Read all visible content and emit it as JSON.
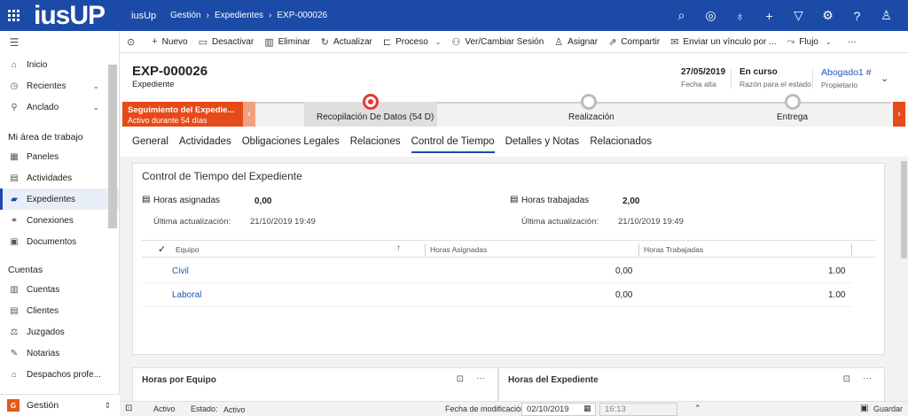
{
  "topbar": {
    "logo": "iusUP",
    "app_name": "iusUp",
    "breadcrumb": [
      "Gestión",
      "Expedientes",
      "EXP-000026"
    ],
    "icons": [
      "search-icon",
      "task-icon",
      "lightbulb-icon",
      "plus-icon",
      "filter-icon",
      "gear-icon",
      "help-icon",
      "user-icon"
    ]
  },
  "sidebar": {
    "top_items": [
      {
        "label": "Inicio",
        "icon": "home-icon"
      },
      {
        "label": "Recientes",
        "icon": "clock-icon",
        "expandable": true
      },
      {
        "label": "Anclado",
        "icon": "pin-icon",
        "expandable": true
      }
    ],
    "section1_title": "Mi área de trabajo",
    "section1_items": [
      {
        "label": "Paneles",
        "icon": "dashboard-icon"
      },
      {
        "label": "Actividades",
        "icon": "activities-icon"
      },
      {
        "label": "Expedientes",
        "icon": "folder-icon",
        "active": true
      },
      {
        "label": "Conexiones",
        "icon": "connections-icon"
      },
      {
        "label": "Documentos",
        "icon": "document-icon"
      }
    ],
    "section2_title": "Cuentas",
    "section2_items": [
      {
        "label": "Cuentas",
        "icon": "accounts-icon"
      },
      {
        "label": "Clientes",
        "icon": "clients-icon"
      },
      {
        "label": "Juzgados",
        "icon": "court-icon"
      },
      {
        "label": "Notarias",
        "icon": "notary-icon"
      },
      {
        "label": "Despachos profe...",
        "icon": "office-icon"
      }
    ],
    "area_badge": "G",
    "area_label": "Gestión"
  },
  "commands": [
    {
      "label": "Nuevo",
      "icon": "plus-icon"
    },
    {
      "label": "Desactivar",
      "icon": "deactivate-icon"
    },
    {
      "label": "Eliminar",
      "icon": "trash-icon"
    },
    {
      "label": "Actualizar",
      "icon": "refresh-icon"
    },
    {
      "label": "Proceso",
      "icon": "process-icon",
      "dropdown": true
    },
    {
      "label": "Ver/Cambiar Sesión",
      "icon": "session-icon"
    },
    {
      "label": "Asignar",
      "icon": "assign-icon"
    },
    {
      "label": "Compartir",
      "icon": "share-icon"
    },
    {
      "label": "Enviar un vínculo por ...",
      "icon": "email-link-icon"
    },
    {
      "label": "Flujo",
      "icon": "flow-icon",
      "dropdown": true
    }
  ],
  "more_label": "···",
  "record": {
    "title": "EXP-000026",
    "type": "Expediente",
    "date_value": "27/05/2019",
    "date_label": "Fecha alta",
    "status_value": "En curso",
    "status_label": "Razón para el estado",
    "owner_value": "Abogado1 #",
    "owner_label": "Propietario"
  },
  "bpf": {
    "status_title": "Seguimiento del Expedie...",
    "status_sub": "Activo durante 54 días",
    "stages": [
      {
        "label": "Recopilación De Datos  (54 D)",
        "active": true
      },
      {
        "label": "Realización",
        "active": false
      },
      {
        "label": "Entrega",
        "active": false
      }
    ]
  },
  "tabs": [
    "General",
    "Actividades",
    "Obligaciones Legales",
    "Relaciones",
    "Control de Tiempo",
    "Detalles y Notas",
    "Relacionados"
  ],
  "active_tab": "Control de Tiempo",
  "control": {
    "title": "Control de Tiempo del Expediente",
    "assigned_label": "Horas asignadas",
    "assigned_value": "0,00",
    "worked_label": "Horas trabajadas",
    "worked_value": "2,00",
    "updated_label": "Última actualización:",
    "updated_left": "21/10/2019 19:49",
    "updated_right": "21/10/2019 19:49",
    "grid_headers": [
      "Equipo",
      "Horas Asignadas",
      "Horas Trabajadas"
    ],
    "rows": [
      {
        "team": "Civil",
        "assigned": "0,00",
        "worked": "1.00"
      },
      {
        "team": "Laboral",
        "assigned": "0,00",
        "worked": "1.00"
      }
    ]
  },
  "bottom_cards": {
    "left_title": "Horas por Equipo",
    "right_title": "Horas del Expediente"
  },
  "statusbar": {
    "state": "Activo",
    "estado_label": "Estado:",
    "estado_value": "Activo",
    "mod_label": "Fecha de modificación:",
    "mod_date": "02/10/2019",
    "mod_time": "16:13",
    "save_label": "Guardar"
  },
  "colors": {
    "brand": "#1b4aa7",
    "status_red": "#e64a19",
    "link": "#1b5ac2"
  }
}
